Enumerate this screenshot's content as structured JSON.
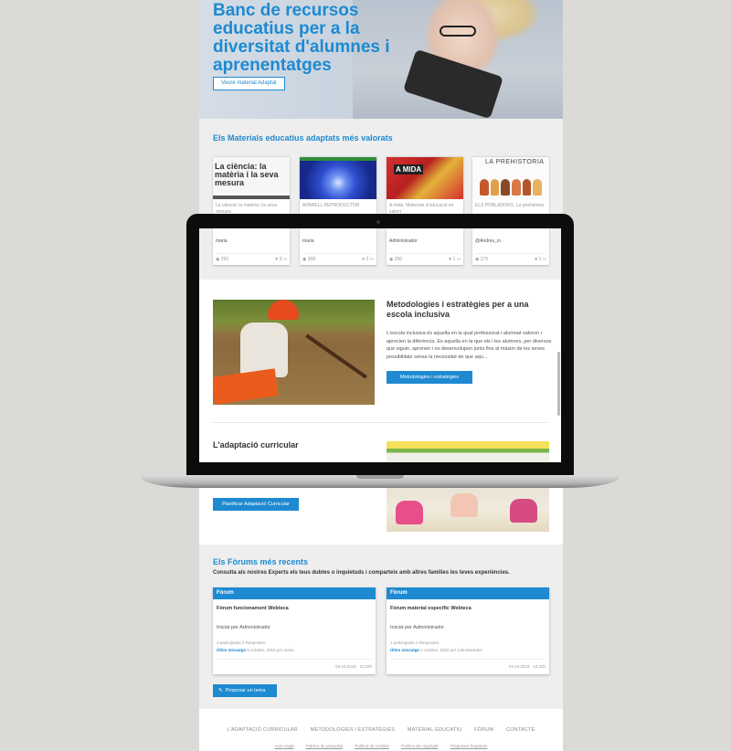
{
  "hero": {
    "title": "Banc de recursos educatius per a la diversitat d'alumnes i aprenentatges",
    "button": "Veure material Adaptat"
  },
  "materials": {
    "title": "Els Materials educatius adaptats més valorats",
    "cards": [
      {
        "image_text": "La ciència: la matèria i la seva mesura",
        "desc": "La ciència: la matèria i la seva mesura",
        "author": "maria",
        "views": "255",
        "likes": "3"
      },
      {
        "image_text": "",
        "desc": "APARELL REPRODUCTOR",
        "author": "maria",
        "views": "308",
        "likes": "2"
      },
      {
        "image_text": "A MIDA",
        "desc": "A mida. Materials d'educació en valors",
        "author": "Administrador",
        "views": "250",
        "likes": "1"
      },
      {
        "image_text": "LA PREHISTORIA",
        "desc": "ELS POBLADORS. La prehistòria",
        "author": "@Andreu_io",
        "views": "275",
        "likes": "1"
      }
    ]
  },
  "methodologies": {
    "title": "Metodologies i estratègies per a una escola inclusiva",
    "text": "L'escola inclusiva és aquella en la qual professorat i alumnat valoren i aprecien la diferència. Es aquella en la que els i les alumnes, per diversos que siguin, aprenen i es desenvolupen junts fins al màxim de les seves possibilitats sense la necessitat de que aqu...",
    "button": "Metodologies i estratègies"
  },
  "adaptation": {
    "title": "L'adaptació curricular",
    "button": "Planificar Adaptació Curricular"
  },
  "forums": {
    "title": "Els Fòrums més recents",
    "subtitle": "Consulta als nostres Experts els teus dubtes o inquietuds i comparteix amb altres famílies les teves experiències.",
    "cards": [
      {
        "header": "Fòrum",
        "title": "Fòrum funcionament Webteca",
        "started_by": "Iniciat per Administrador",
        "participants": "3 participants 4 Respostes",
        "last_label": "Últim missatge",
        "last_value": "9 octubre, 2018 per maria",
        "date": "04.10.2018",
        "time": "11:19h"
      },
      {
        "header": "Fòrum",
        "title": "Fòrum material especific Webteca",
        "started_by": "Iniciat per Administrador",
        "participants": "1 participants 1 Respostes",
        "last_label": "Últim missatge",
        "last_value": "4 octubre, 2018 per Administrador",
        "date": "04.10.2018",
        "time": "12:22h"
      }
    ],
    "propose_button": "Proposar un tema"
  },
  "footer": {
    "nav": [
      "L'ADAPTACIÓ CURRICULAR",
      "METODOLOGIES I ESTRATÈGIES",
      "MATERIAL EDUCATIU",
      "FÒRUM",
      "CONTACTE"
    ],
    "legal": [
      "Avís Legal",
      "Política de privacitat",
      "Política de cookies",
      "Política de copyright",
      "Preguntes freqüents"
    ]
  },
  "colors": {
    "accent": "#1d8ad1",
    "background": "#dcdad6",
    "section_bg": "#eeeeee"
  },
  "icons": [
    "eye-icon",
    "heart-icon",
    "share-icon",
    "pencil-icon"
  ]
}
